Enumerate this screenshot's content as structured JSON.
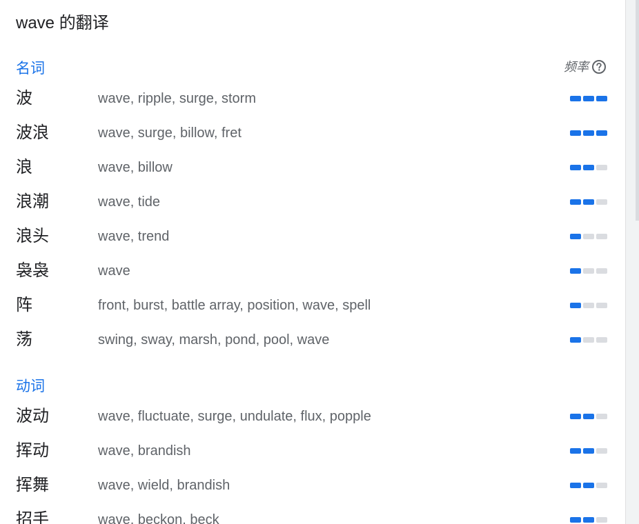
{
  "title": "wave 的翻译",
  "frequency_label": "频率",
  "colors": {
    "accent": "#1a73e8",
    "bar_off": "#dadce0",
    "word": "#202124",
    "translation": "#5f6368"
  },
  "sections": [
    {
      "pos": "名词",
      "entries": [
        {
          "word": "波",
          "translations": "wave, ripple, surge, storm",
          "frequency": 3
        },
        {
          "word": "波浪",
          "translations": "wave, surge, billow, fret",
          "frequency": 3
        },
        {
          "word": "浪",
          "translations": "wave, billow",
          "frequency": 2
        },
        {
          "word": "浪潮",
          "translations": "wave, tide",
          "frequency": 2
        },
        {
          "word": "浪头",
          "translations": "wave, trend",
          "frequency": 1
        },
        {
          "word": "袅袅",
          "translations": "wave",
          "frequency": 1
        },
        {
          "word": "阵",
          "translations": "front, burst, battle array, position, wave, spell",
          "frequency": 1
        },
        {
          "word": "荡",
          "translations": "swing, sway, marsh, pond, pool, wave",
          "frequency": 1
        }
      ]
    },
    {
      "pos": "动词",
      "entries": [
        {
          "word": "波动",
          "translations": "wave, fluctuate, surge, undulate, flux, popple",
          "frequency": 2
        },
        {
          "word": "挥动",
          "translations": "wave, brandish",
          "frequency": 2
        },
        {
          "word": "挥舞",
          "translations": "wave, wield, brandish",
          "frequency": 2
        },
        {
          "word": "招手",
          "translations": "wave, beckon, beck",
          "frequency": 2
        }
      ]
    }
  ]
}
